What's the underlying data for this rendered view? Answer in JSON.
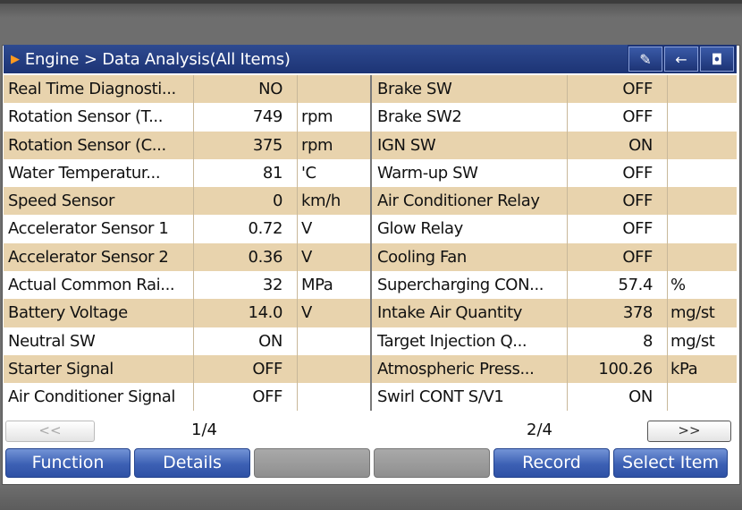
{
  "header": {
    "title": "Engine > Data Analysis(All Items)",
    "buttons": [
      {
        "icon": "pen-icon",
        "glyph": "✎"
      },
      {
        "icon": "back-arrow-icon",
        "glyph": "←"
      },
      {
        "icon": "camera-icon",
        "glyph": "◘"
      }
    ]
  },
  "left_rows": [
    {
      "name": "Real Time Diagnosti...",
      "value": "NO",
      "unit": ""
    },
    {
      "name": "Rotation Sensor (T...",
      "value": "749",
      "unit": "rpm"
    },
    {
      "name": "Rotation Sensor (C...",
      "value": "375",
      "unit": "rpm"
    },
    {
      "name": "Water Temperatur...",
      "value": "81",
      "unit": "'C"
    },
    {
      "name": "Speed Sensor",
      "value": "0",
      "unit": "km/h"
    },
    {
      "name": "Accelerator Sensor 1",
      "value": "0.72",
      "unit": "V"
    },
    {
      "name": "Accelerator Sensor 2",
      "value": "0.36",
      "unit": "V"
    },
    {
      "name": "Actual Common Rai...",
      "value": "32",
      "unit": "MPa"
    },
    {
      "name": "Battery Voltage",
      "value": "14.0",
      "unit": "V"
    },
    {
      "name": "Neutral SW",
      "value": "ON",
      "unit": ""
    },
    {
      "name": "Starter Signal",
      "value": "OFF",
      "unit": ""
    },
    {
      "name": "Air Conditioner Signal",
      "value": "OFF",
      "unit": ""
    }
  ],
  "right_rows": [
    {
      "name": "Brake SW",
      "value": "OFF",
      "unit": ""
    },
    {
      "name": "Brake SW2",
      "value": "OFF",
      "unit": ""
    },
    {
      "name": "IGN SW",
      "value": "ON",
      "unit": ""
    },
    {
      "name": "Warm-up SW",
      "value": "OFF",
      "unit": ""
    },
    {
      "name": "Air Conditioner Relay",
      "value": "OFF",
      "unit": ""
    },
    {
      "name": "Glow Relay",
      "value": "OFF",
      "unit": ""
    },
    {
      "name": "Cooling Fan",
      "value": "OFF",
      "unit": ""
    },
    {
      "name": "Supercharging CON...",
      "value": "57.4",
      "unit": "%"
    },
    {
      "name": "Intake Air Quantity",
      "value": "378",
      "unit": "mg/st"
    },
    {
      "name": "Target Injection Q...",
      "value": "8",
      "unit": "mg/st"
    },
    {
      "name": "Atmospheric Press...",
      "value": "100.26",
      "unit": "kPa"
    },
    {
      "name": "Swirl CONT S/V1",
      "value": "ON",
      "unit": ""
    }
  ],
  "pager": {
    "prev_label": "<<",
    "left_page": "1/4",
    "right_page": "2/4",
    "next_label": ">>"
  },
  "function_bar": {
    "function_label": "Function",
    "details_label": "Details",
    "record_label": "Record",
    "select_item_label": "Select Item"
  },
  "colors": {
    "title_bar": "#1d3475",
    "row_alt": "#e8d3ad",
    "button_blue": "#3c60b4",
    "title_arrow": "#ff9a1f"
  }
}
